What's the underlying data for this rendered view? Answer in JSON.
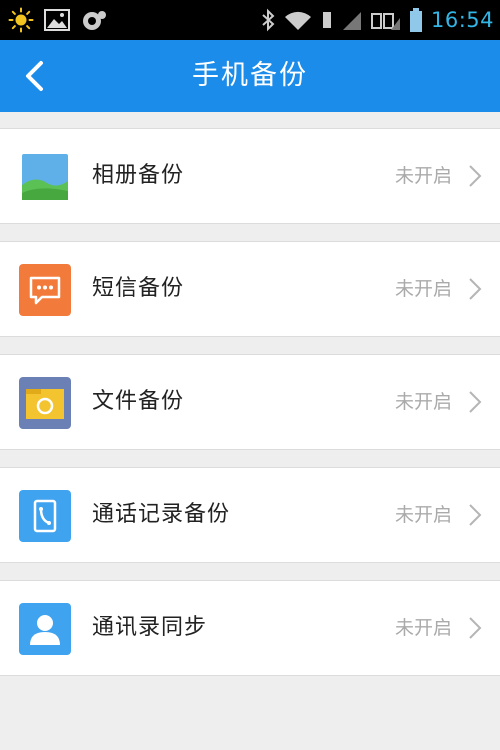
{
  "status_bar": {
    "time": "16:54",
    "icons": [
      "weather-icon",
      "image-icon",
      "sync-icon",
      "bluetooth-icon",
      "wifi-icon",
      "sim-icon",
      "signal-icon",
      "battery-icon"
    ]
  },
  "header": {
    "title": "手机备份",
    "back_icon": "chevron-left-icon"
  },
  "items": [
    {
      "label": "相册备份",
      "status": "未开启",
      "icon": "album-icon",
      "color": "#5fb0e8"
    },
    {
      "label": "短信备份",
      "status": "未开启",
      "icon": "sms-icon",
      "color": "#f27b3c"
    },
    {
      "label": "文件备份",
      "status": "未开启",
      "icon": "folder-icon",
      "color": "#6b80b5"
    },
    {
      "label": "通话记录备份",
      "status": "未开启",
      "icon": "call-log-icon",
      "color": "#3fa3f0"
    },
    {
      "label": "通讯录同步",
      "status": "未开启",
      "icon": "contacts-icon",
      "color": "#3fa3f0"
    }
  ],
  "colors": {
    "header_bg": "#1c8cea",
    "status_time": "#33b5e5",
    "page_bg": "#eeeeee"
  }
}
